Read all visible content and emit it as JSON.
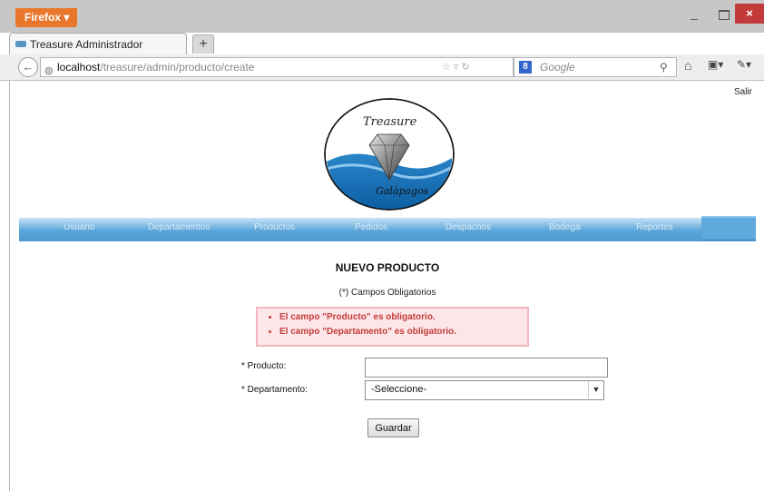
{
  "browser": {
    "menu_label": "Firefox",
    "tab_title": "Treasure Administrador",
    "new_tab": "+",
    "url_host": "localhost",
    "url_path": "/treasure/admin/producto/create",
    "search_engine": "Google",
    "minimize": "_",
    "close": "×"
  },
  "page": {
    "logout": "Salir",
    "logo_text_top": "Treasure",
    "logo_text_bottom": "Galápagos",
    "menu": [
      "Usuario",
      "Departamentos",
      "Productos",
      "Pedidos",
      "Despachos",
      "Bodega",
      "Reportes"
    ],
    "form_title": "NUEVO PRODUCTO",
    "required_note": "(*) Campos Obligatorios",
    "errors": [
      "El campo \"Producto\" es obligatorio.",
      "El campo \"Departamento\" es obligatorio."
    ],
    "fields": {
      "producto_label": "* Producto:",
      "producto_value": "",
      "departamento_label": "* Departamento:",
      "departamento_selected": "-Seleccione-"
    },
    "save_button": "Guardar"
  },
  "colors": {
    "menu_blue": "#4f9bd2",
    "error_bg": "#fce6e8",
    "error_text": "#c43c3c",
    "firefox_orange": "#e8772b"
  }
}
